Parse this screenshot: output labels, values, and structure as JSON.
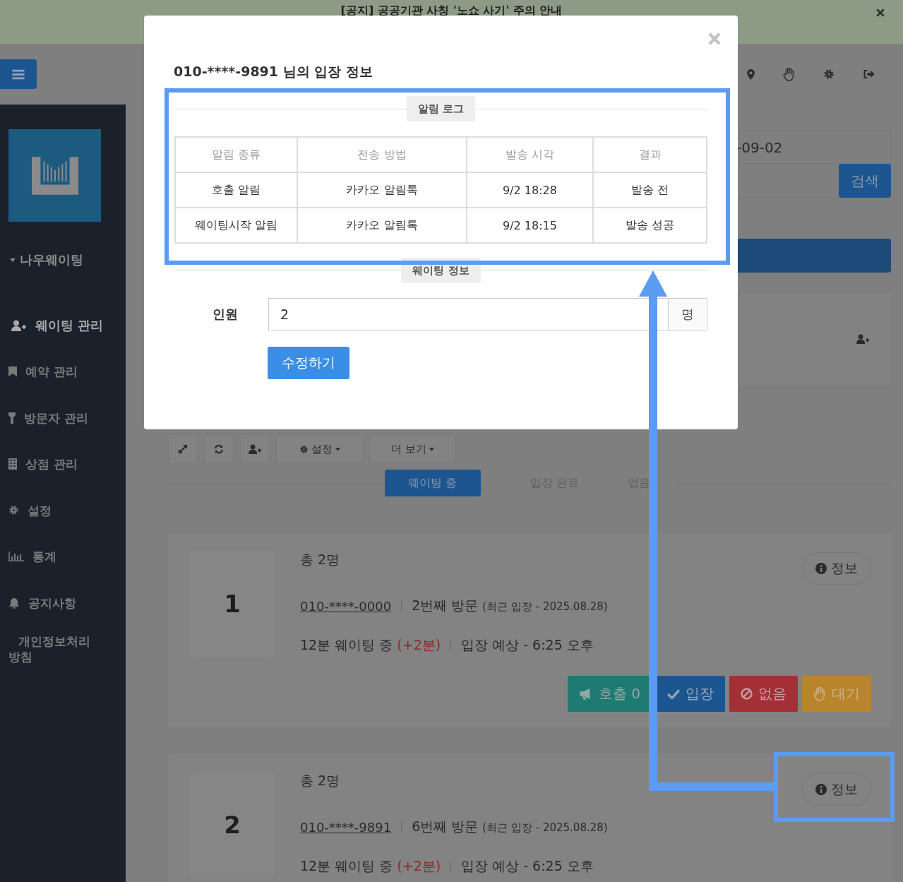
{
  "notice": {
    "text": "[공지] 공공기관 사칭 '노쇼 사기' 주의 안내"
  },
  "sidebar": {
    "brand": "나우웨이팅",
    "items": [
      {
        "label": "웨이팅 관리",
        "selected": true
      },
      {
        "label": "예약 관리",
        "selected": false
      },
      {
        "label": "방문자 관리",
        "selected": false
      },
      {
        "label": "상점 관리",
        "selected": false
      },
      {
        "label": "설정",
        "selected": false
      },
      {
        "label": "통계",
        "selected": false
      },
      {
        "label": "공지사항",
        "selected": false
      },
      {
        "label": "개인정보처리 방침",
        "selected": false
      }
    ]
  },
  "search": {
    "date_value": "-09-02",
    "button": "검색"
  },
  "toolbar": {
    "settings": "설정",
    "more": "더 보기"
  },
  "status_tabs": [
    {
      "label": "웨이팅 중",
      "selected": true
    },
    {
      "label": "입장 완료",
      "selected": false
    },
    {
      "label": "없음",
      "selected": false
    }
  ],
  "queue": [
    {
      "number": "1",
      "total": "총 2명",
      "phone": "010-****-0000",
      "visits": "2번째 방문",
      "last_visit": "(최근 입장 - 2025.08.28)",
      "waiting": "12분 웨이팅 중",
      "extra": "(+2분)",
      "expected": "입장 예상 - 6:25 오후",
      "info": "정보",
      "actions": [
        {
          "label": "호출 0",
          "kind": "call"
        },
        {
          "label": "입장",
          "kind": "enter"
        },
        {
          "label": "없음",
          "kind": "noshow"
        },
        {
          "label": "대기",
          "kind": "hold"
        }
      ]
    },
    {
      "number": "2",
      "total": "총 2명",
      "phone": "010-****-9891",
      "visits": "6번째 방문",
      "last_visit": "(최근 입장 - 2025.08.28)",
      "waiting": "12분 웨이팅 중",
      "extra": "(+2분)",
      "expected": "입장 예상 - 6:25 오후",
      "info": "정보"
    }
  ],
  "modal": {
    "title": "010-****-9891 님의 입장 정보",
    "log_title": "알림 로그",
    "columns": [
      "알림 종류",
      "전송 방법",
      "발송 시각",
      "결과"
    ],
    "rows": [
      [
        "호출 알림",
        "카카오 알림톡",
        "9/2 18:28",
        "발송 전"
      ],
      [
        "웨이팅시작 알림",
        "카카오 알림톡",
        "9/2 18:15",
        "발송 성공"
      ]
    ],
    "waiting_title": "웨이팅 정보",
    "field_label": "인원",
    "field_value": "2",
    "unit": "명",
    "save": "수정하기"
  }
}
